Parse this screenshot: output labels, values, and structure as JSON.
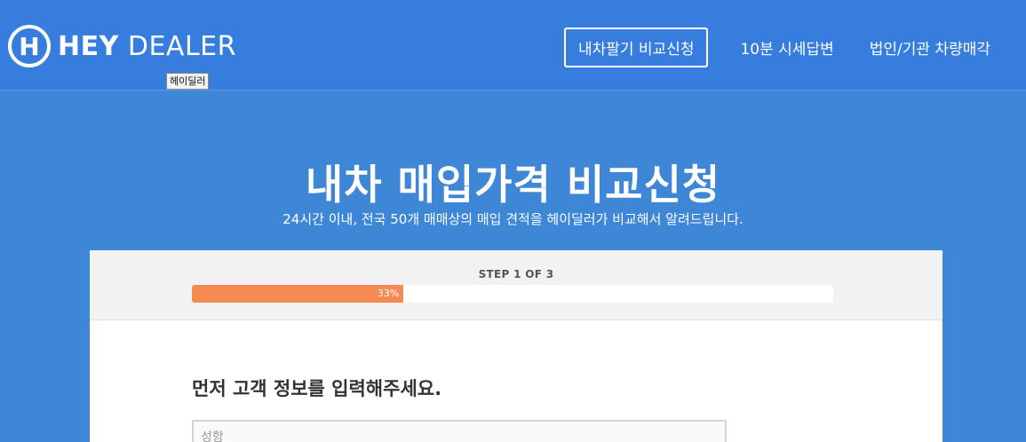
{
  "header": {
    "logo_letter": "H",
    "logo_bold": "HEY",
    "logo_light": "DEALER",
    "tooltip": "헤이딜러",
    "nav": {
      "primary_button": "내차팔기 비교신청",
      "link_quote": "10분 시세답변",
      "link_corporate": "법인/기관 차량매각"
    }
  },
  "hero": {
    "title": "내차 매입가격 비교신청",
    "subtitle": "24시간 이내, 전국 50개 매매상의 매입 견적을 헤이딜러가 비교해서 알려드립니다."
  },
  "progress": {
    "step_label": "STEP 1 OF 3",
    "percent_label": "33%",
    "fraction": 0.33
  },
  "form": {
    "title": "먼저 고객 정보를 입력해주세요.",
    "name_placeholder": "성함",
    "name_value": ""
  },
  "colors": {
    "header_bg": "#367dde",
    "page_bg": "#3e87d6",
    "progress_fill": "#f58b53"
  }
}
